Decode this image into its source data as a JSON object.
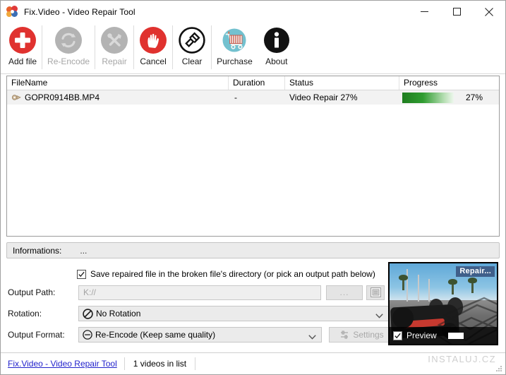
{
  "window": {
    "title": "Fix.Video - Video Repair Tool",
    "app_icon": "pinwheel-icon",
    "controls": {
      "minimize": "minimize-icon",
      "maximize": "maximize-icon",
      "close": "close-icon"
    }
  },
  "toolbar": {
    "buttons": [
      {
        "label": "Add file",
        "icon": "add-file-icon",
        "enabled": true
      },
      {
        "label": "Re-Encode",
        "icon": "re-encode-icon",
        "enabled": false
      },
      {
        "label": "Repair",
        "icon": "repair-icon",
        "enabled": false
      },
      {
        "label": "Cancel",
        "icon": "cancel-icon",
        "enabled": true
      },
      {
        "label": "Clear",
        "icon": "clear-icon",
        "enabled": true
      },
      {
        "label": "Purchase",
        "icon": "purchase-icon",
        "enabled": true
      },
      {
        "label": "About",
        "icon": "about-icon",
        "enabled": true
      }
    ]
  },
  "file_list": {
    "columns": [
      "FileName",
      "Duration",
      "Status",
      "Progress"
    ],
    "rows": [
      {
        "filename": "GOPR0914BB.MP4",
        "duration": "-",
        "status": "Video Repair 27%",
        "progress_label": "27%",
        "progress_value": 27
      }
    ]
  },
  "informations": {
    "label": "Informations:",
    "value": "..."
  },
  "options": {
    "save_in_broken_dir_label": "Save repaired file in the broken file's directory (or pick an output path below)",
    "save_in_broken_dir_checked": true,
    "output_path_label": "Output Path:",
    "output_path_value": "K://",
    "browse_button_label": "...",
    "folder_button_icon": "folder-window-icon",
    "rotation_label": "Rotation:",
    "rotation_value": "No Rotation",
    "rotation_icon": "no-entry-icon",
    "output_format_label": "Output Format:",
    "output_format_value": "Re-Encode (Keep same quality)",
    "output_format_icon": "minus-circle-icon",
    "settings_button_label": "Settings",
    "settings_icon": "sliders-icon"
  },
  "preview": {
    "badge": "Repair...",
    "checkbox_label": "Preview",
    "checkbox_checked": true,
    "slider_name": "preview-position-slider"
  },
  "status_bar": {
    "link": "Fix.Video - Video Repair Tool",
    "count_text": "1 videos in list",
    "resize_grip": "resize-grip-icon"
  },
  "watermark": "INSTALUJ.CZ",
  "colors": {
    "accent_red": "#e03a3a",
    "progress_green": "#2f9c30",
    "purchase_teal": "#73c1cf",
    "link_blue": "#2222cc"
  }
}
